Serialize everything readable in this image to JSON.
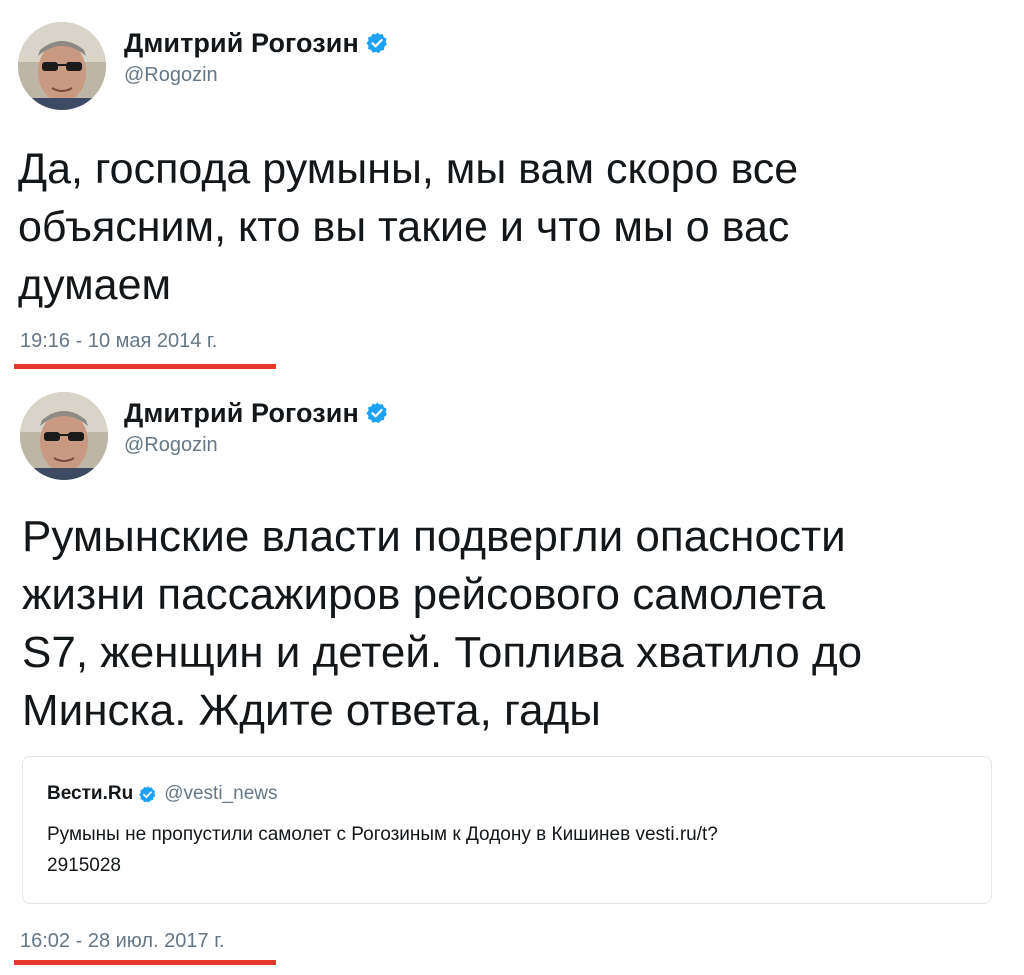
{
  "tweets": [
    {
      "author_name": "Дмитрий Рогозин",
      "author_handle": "@Rogozin",
      "verified_icon": "verified-badge-icon",
      "text": "Да, господа румыны, мы вам скоро все\nобъясним, кто вы такие и что мы о вас\nдумаем",
      "timestamp": "19:16 - 10 мая 2014 г."
    },
    {
      "author_name": "Дмитрий Рогозин",
      "author_handle": "@Rogozin",
      "verified_icon": "verified-badge-icon",
      "text": "Румынские власти подвергли опасности\nжизни пассажиров рейсового самолета\nS7, женщин и детей. Топлива хватило до\nМинска. Ждите ответа, гады",
      "quoted": {
        "author_name": "Вести.Ru",
        "author_handle": "@vesti_news",
        "text": "Румыны не пропустили самолет с Рогозиным к Додону в Кишинев vesti.ru/t?\n2915028"
      },
      "timestamp": "16:02 - 28 июл. 2017 г."
    }
  ],
  "colors": {
    "verified": "#1da1f2",
    "secondary_text": "#657786",
    "highlight_underline": "#e8372b",
    "border": "#e1e8ed"
  }
}
